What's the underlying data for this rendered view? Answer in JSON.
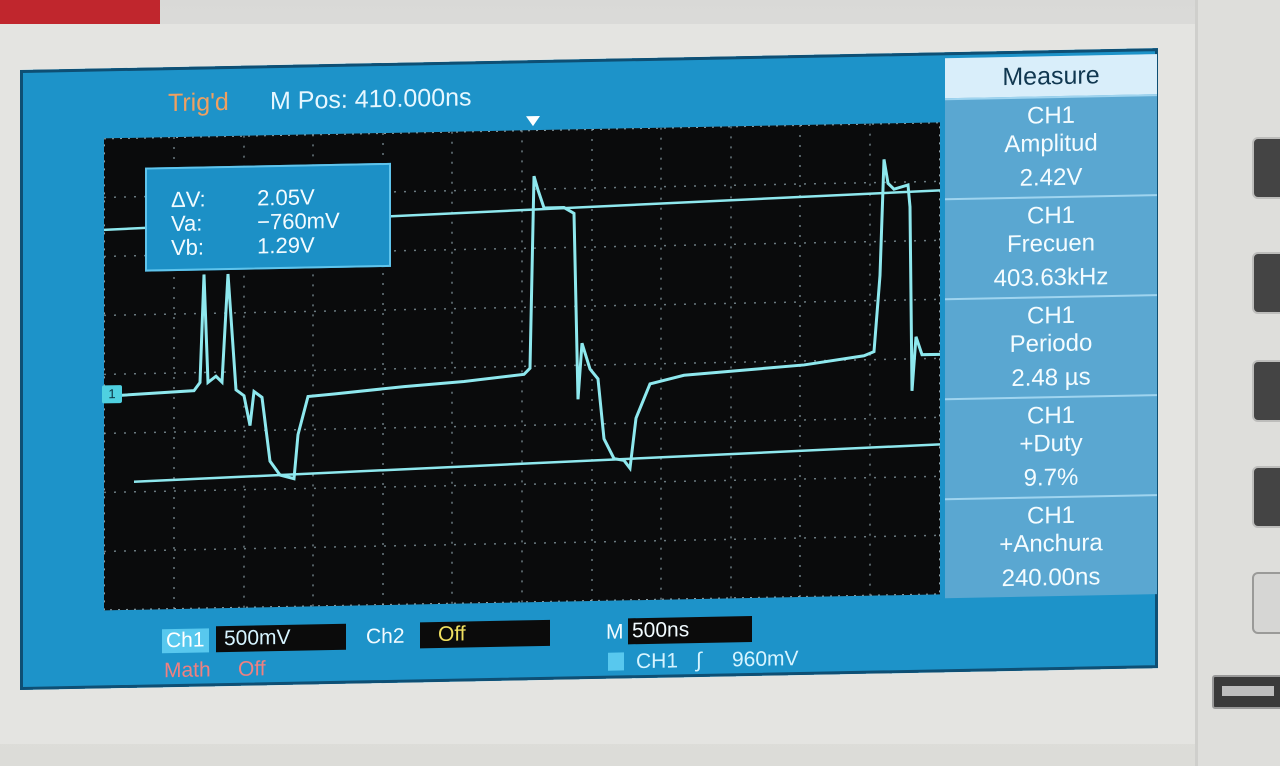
{
  "instrument": {
    "header": {
      "trig_status": "Trig'd",
      "m_pos_label": "M Pos:",
      "m_pos_value": "410.000ns"
    },
    "cursor_readout": {
      "delta_v_label": "ΔV:",
      "delta_v_value": "2.05V",
      "va_label": "Va:",
      "va_value": "−760mV",
      "vb_label": "Vb:",
      "vb_value": "1.29V"
    },
    "channel_marker": "1",
    "measure_panel": {
      "title": "Measure",
      "items": [
        {
          "channel": "CH1",
          "name": "Amplitud",
          "value": "2.42V"
        },
        {
          "channel": "CH1",
          "name": "Frecuen",
          "value": "403.63kHz"
        },
        {
          "channel": "CH1",
          "name": "Periodo",
          "value": "2.48 µs"
        },
        {
          "channel": "CH1",
          "name": "+Duty",
          "value": "9.7%"
        },
        {
          "channel": "CH1",
          "name": "+Anchura",
          "value": "240.00ns"
        }
      ]
    },
    "bottom_bar": {
      "ch1_label": "Ch1",
      "ch1_scale": "500mV",
      "ch2_label": "Ch2",
      "ch2_state": "Off",
      "math_label": "Math",
      "math_state": "Off",
      "timebase_label": "M",
      "timebase_value": "500ns",
      "trigger_source": "CH1",
      "trigger_slope": "∫",
      "trigger_level": "960mV"
    },
    "colors": {
      "screen_bg": "#1d93c9",
      "trace": "#8ee8ee",
      "trig_text": "#f0a060",
      "math_text": "#f08080",
      "ch2_text": "#f0e060"
    }
  }
}
